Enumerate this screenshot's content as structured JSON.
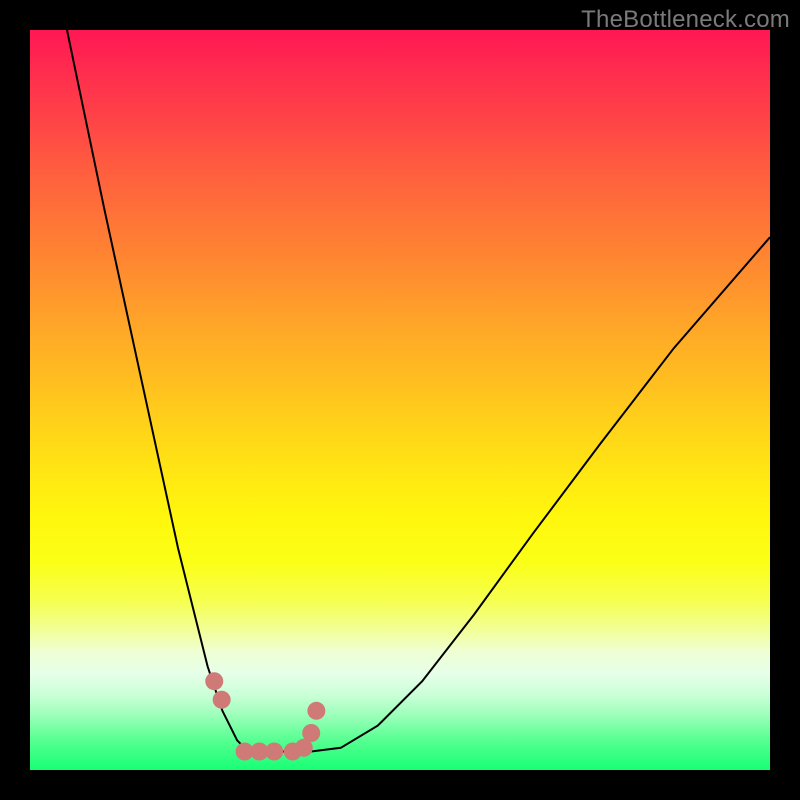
{
  "watermark": "TheBottleneck.com",
  "chart_data": {
    "type": "line",
    "title": "",
    "xlabel": "",
    "ylabel": "",
    "xlim": [
      0,
      100
    ],
    "ylim": [
      0,
      100
    ],
    "grid": false,
    "legend": false,
    "series": [
      {
        "name": "curve",
        "color": "#000000",
        "x": [
          5,
          10,
          15,
          20,
          22,
          24,
          26,
          28,
          29,
          30,
          31,
          32,
          35,
          38,
          42,
          47,
          53,
          60,
          68,
          77,
          87,
          100
        ],
        "y": [
          100,
          76,
          53,
          30,
          22,
          14,
          8,
          4,
          3,
          2.6,
          2.5,
          2.5,
          2.5,
          2.5,
          3,
          6,
          12,
          21,
          32,
          44,
          57,
          72
        ]
      }
    ],
    "markers": [
      {
        "name": "dots",
        "color": "#d07a78",
        "radius": 9,
        "x": [
          24.9,
          25.9,
          29.0,
          31.0,
          33.0,
          35.5,
          37.0,
          38.0,
          38.7
        ],
        "y": [
          12.0,
          9.5,
          2.5,
          2.5,
          2.5,
          2.5,
          3.0,
          5.0,
          8.0
        ]
      }
    ]
  }
}
